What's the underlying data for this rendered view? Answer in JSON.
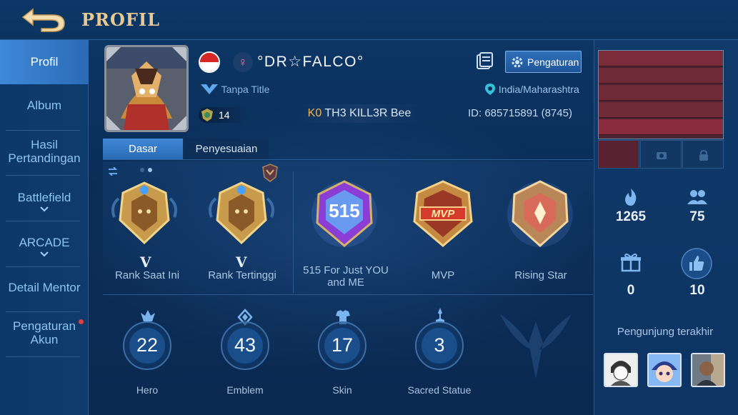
{
  "header": {
    "title": "PROFIL"
  },
  "sidebar": {
    "items": [
      {
        "label": "Profil"
      },
      {
        "label": "Album"
      },
      {
        "label": "Hasil Pertandingan"
      },
      {
        "label": "Battlefield"
      },
      {
        "label": "ARCADE"
      },
      {
        "label": "Detail Mentor"
      },
      {
        "label": "Pengaturan Akun"
      }
    ]
  },
  "profile": {
    "name": "°DR☆FALCO°",
    "title": "Tanpa Title",
    "location": "India/Maharashtra",
    "level": "14",
    "squad_tag": "K0",
    "squad_name": "TH3 KILL3R Bee",
    "id": "ID: 685715891 (8745)",
    "settings_label": "Pengaturan"
  },
  "tabs": [
    {
      "label": "Dasar"
    },
    {
      "label": "Penyesuaian"
    }
  ],
  "medals": [
    {
      "label": "Rank Saat Ini",
      "tier": "V"
    },
    {
      "label": "Rank Tertinggi",
      "tier": "V"
    },
    {
      "label": "515 For Just YOU and ME",
      "emblem_text": "515"
    },
    {
      "label": "MVP",
      "emblem_text": "MVP"
    },
    {
      "label": "Rising Star"
    }
  ],
  "stats": [
    {
      "label": "Hero",
      "value": "22"
    },
    {
      "label": "Emblem",
      "value": "43"
    },
    {
      "label": "Skin",
      "value": "17"
    },
    {
      "label": "Sacred Statue",
      "value": "3"
    }
  ],
  "right_panel": {
    "popularity": "1265",
    "followers": "75",
    "gifts": "0",
    "likes": "10",
    "visitors_label": "Pengunjung terakhir"
  },
  "colors": {
    "accent": "#3f88d6",
    "gold": "#e9c98f",
    "squad_tag": "#f1b352"
  }
}
